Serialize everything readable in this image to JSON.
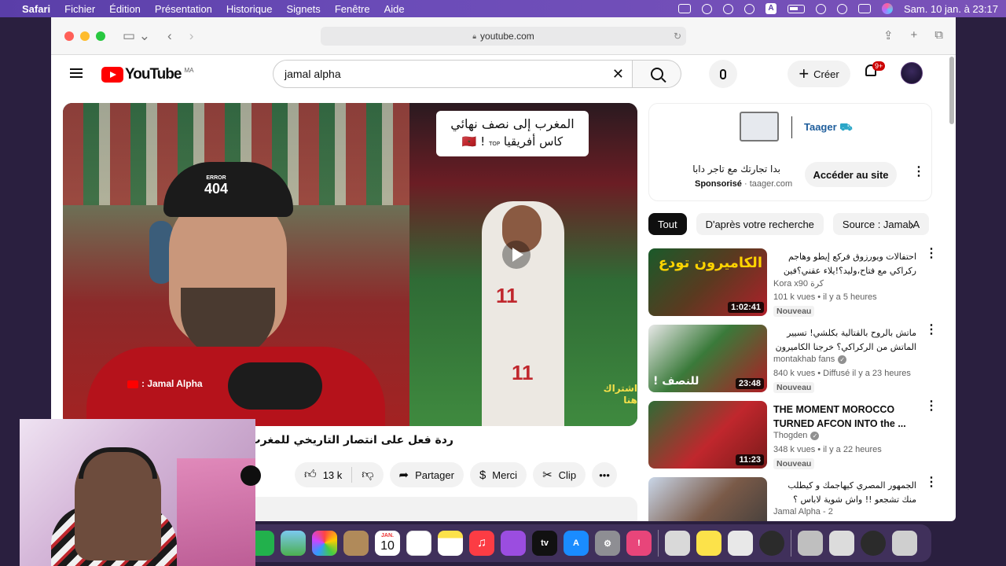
{
  "menubar": {
    "app": "Safari",
    "items": [
      "Fichier",
      "Édition",
      "Présentation",
      "Historique",
      "Signets",
      "Fenêtre",
      "Aide"
    ],
    "clock": "Sam. 10 jan. à  23:17"
  },
  "browser": {
    "url": "youtube.com"
  },
  "youtube": {
    "logo_text": "YouTube",
    "region": "MA",
    "search_value": "jamal alpha",
    "create_label": "Créer",
    "notifications_badge": "9+"
  },
  "video": {
    "banner_line1": "المغرب إلى نصف نهائي",
    "banner_line2": "كاس أفريقيا 🇲🇦 !",
    "banner_top": "TOP",
    "cap_text": "404",
    "cap_top": "ERROR",
    "jersey_number": "11",
    "watermark": ": Jamal Alpha",
    "subscribe_overlay": "اشتراك هنا",
    "title": "ردة فعل على انتصار التاريخي للمغرب ضد ا",
    "likes": "13 k",
    "share_label": "Partager",
    "thanks_label": "Merci",
    "clip_label": "Clip"
  },
  "ad": {
    "brand": "Taager",
    "text": "بدا تجارتك مع تاجر دابا",
    "sponsored": "Sponsorisé",
    "domain": "taager.com",
    "cta": "Accéder au site"
  },
  "chips": [
    "Tout",
    "D'après votre recherche",
    "Source : Jamal A"
  ],
  "recommendations": [
    {
      "title": "احتفالات ويورزوق فركع إيطو وهاجم ركراكي مع فتاح،وليد؟!يلاء عقني؟فين كنتي؟",
      "channel": "Kora x90 كرة",
      "stats": "101 k vues • il y a 5 heures",
      "badge": "Nouveau",
      "duration": "1:02:41",
      "thumb_text": "الكاميرون تودع",
      "dir": "rtl"
    },
    {
      "title": "ماتش بالروح بالقتالية بكلشي! تسيير الماتش من الركراكي؟ خرجنا الكاميرون و دزنا ...",
      "channel": "montakhab fans",
      "stats": "840 k vues • Diffusé il y a 23 heures",
      "badge": "Nouveau",
      "duration": "23:48",
      "thumb_text": "للنصف !",
      "dir": "rtl"
    },
    {
      "title": "THE MOMENT MOROCCO TURNED AFCON INTO the ...",
      "channel": "Thogden",
      "stats": "348 k vues • il y a 22 heures",
      "badge": "Nouveau",
      "duration": "11:23",
      "thumb_text": "",
      "dir": "ltr"
    },
    {
      "title": "الجمهور المصري كيهاجمك و كيطلب منك تشجعو !! واش شوية لاباس ؟",
      "channel": "Jamal Alpha - 2",
      "stats": "",
      "badge": "",
      "duration": "",
      "thumb_text": "",
      "dir": "rtl"
    }
  ],
  "dock": {
    "calendar_month": "JAN.",
    "calendar_day": "10",
    "tv_label": "tv"
  },
  "colors": {
    "youtube_red": "#ff0000",
    "menubar": "#6b4cb8"
  }
}
